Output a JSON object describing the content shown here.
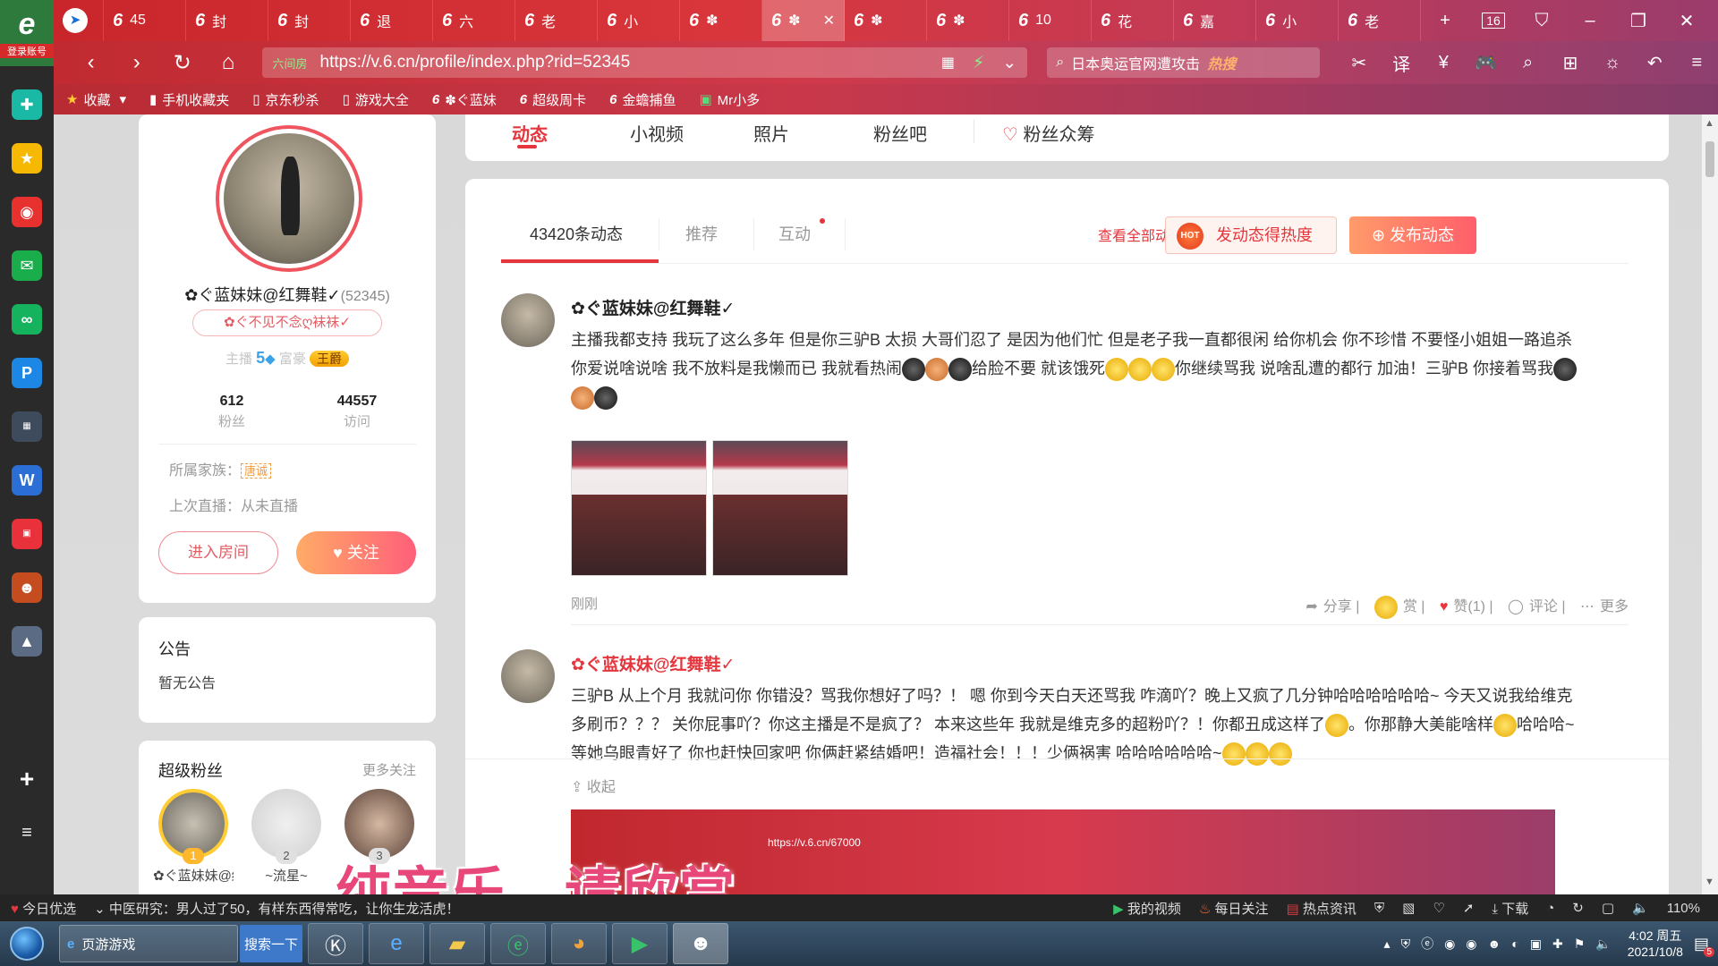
{
  "browser": {
    "logo_label": "登录账号",
    "tabs": [
      {
        "label": "45"
      },
      {
        "label": "封"
      },
      {
        "label": "封"
      },
      {
        "label": "退"
      },
      {
        "label": "六"
      },
      {
        "label": "老"
      },
      {
        "label": "小"
      },
      {
        "label": "✽"
      },
      {
        "label": "✽",
        "active": true
      },
      {
        "label": "✽"
      },
      {
        "label": "✽"
      },
      {
        "label": "10"
      },
      {
        "label": "花"
      },
      {
        "label": "嘉"
      },
      {
        "label": "小"
      },
      {
        "label": "老"
      }
    ],
    "tab_count": "16",
    "url": "https://v.6.cn/profile/index.php?rid=52345",
    "secure_label": "六间房",
    "search_text": "日本奥运官网遭攻击",
    "search_hot": "热搜",
    "bookmarks": [
      "收藏",
      "手机收藏夹",
      "京东秒杀",
      "游戏大全",
      "✽ぐ蓝妹",
      "超级周卡",
      "金蟾捕鱼",
      "Mr小多"
    ]
  },
  "profile": {
    "name": "✿ぐ蓝妹妹@红舞鞋✓",
    "rid": "(52345)",
    "badge": "✿ぐ不见不念ღ袜袜✓",
    "level_prefix": "主播",
    "level_num": "5",
    "rich_label": "富豪",
    "crown_label": "王爵",
    "fans_count": "612",
    "fans_label": "粉丝",
    "visits_count": "44557",
    "visits_label": "访问",
    "family_label": "所属家族：",
    "family_tag": "唐诚",
    "last_live": "上次直播：从未直播",
    "enter_room": "进入房间",
    "follow": "关注"
  },
  "notice": {
    "title": "公告",
    "content": "暂无公告"
  },
  "super_fans": {
    "title": "超级粉丝",
    "more": "更多关注",
    "fans": [
      {
        "rank": "1",
        "name": "✿ぐ蓝妹妹@红舞"
      },
      {
        "rank": "2",
        "name": "~流星~"
      },
      {
        "rank": "3",
        "name": ""
      }
    ]
  },
  "page_tabs": [
    "动态",
    "小视频",
    "照片",
    "粉丝吧",
    "粉丝众筹"
  ],
  "feed": {
    "tabs": [
      "43420条动态",
      "推荐",
      "互动"
    ],
    "view_all": "查看全部动态",
    "hot_icon": "HOT",
    "hot_btn": "发动态得热度",
    "post_btn": "发布动态",
    "posts": [
      {
        "author": "✿ぐ蓝妹妹@红舞鞋✓",
        "text_1": "主播我都支持 我玩了这么多年 但是你三驴B 太损 大哥们忍了 是因为他们忙 但是老子我一直都很闲 给你机会 你不珍惜 不要怪小姐姐一路追杀 你爱说啥说啥 我不放料是我懒而已 我就看热闹",
        "text_2": "给脸不要 就该饿死",
        "text_3": "你继续骂我 说啥乱遭的都行 加油！三驴B 你接着骂我",
        "time": "刚刚",
        "actions": [
          "分享",
          "赏",
          "赞(1)",
          "评论",
          "更多"
        ]
      },
      {
        "author": "✿ぐ蓝妹妹@红舞鞋✓",
        "text_1": "三驴B 从上个月 我就问你 你错没？骂我你想好了吗？！ 嗯 你到今天白天还骂我 咋滴吖？晚上又疯了几分钟哈哈哈哈哈哈~ 今天又说我给维克多刷币？？？ 关你屁事吖？你这主播是不是疯了？ 本来这些年 我就是维克多的超粉吖？！你都丑成这样了",
        "text_2": "。你那静大美能啥样",
        "text_3": "哈哈哈~等她乌眼青好了 你也赶快回家吧 你俩赶紧结婚吧！造福社会！！！少俩祸害 哈哈哈哈哈哈~",
        "collapse": "收起",
        "preview_url": "https://v.6.cn/67000"
      }
    ]
  },
  "caption": "纯音乐，请欣赏",
  "statusbar": {
    "items": [
      "今日优选",
      "中医研究：男人过了50，有样东西得常吃，让你生龙活虎！",
      "我的视频",
      "每日关注",
      "热点资讯",
      "下载"
    ],
    "zoom": "110%"
  },
  "taskbar": {
    "task_label": "页游游戏",
    "search_btn": "搜索一下",
    "time": "4:02 周五",
    "date": "2021/10/8",
    "notify_count": "5"
  }
}
